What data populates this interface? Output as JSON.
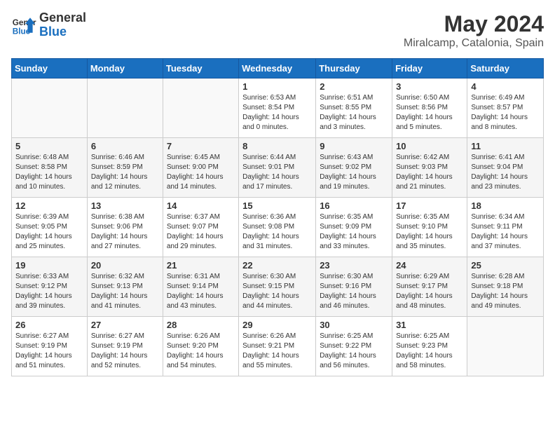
{
  "header": {
    "logo_general": "General",
    "logo_blue": "Blue",
    "month_year": "May 2024",
    "location": "Miralcamp, Catalonia, Spain"
  },
  "days_of_week": [
    "Sunday",
    "Monday",
    "Tuesday",
    "Wednesday",
    "Thursday",
    "Friday",
    "Saturday"
  ],
  "weeks": [
    [
      {
        "day": "",
        "info": ""
      },
      {
        "day": "",
        "info": ""
      },
      {
        "day": "",
        "info": ""
      },
      {
        "day": "1",
        "info": "Sunrise: 6:53 AM\nSunset: 8:54 PM\nDaylight: 14 hours\nand 0 minutes."
      },
      {
        "day": "2",
        "info": "Sunrise: 6:51 AM\nSunset: 8:55 PM\nDaylight: 14 hours\nand 3 minutes."
      },
      {
        "day": "3",
        "info": "Sunrise: 6:50 AM\nSunset: 8:56 PM\nDaylight: 14 hours\nand 5 minutes."
      },
      {
        "day": "4",
        "info": "Sunrise: 6:49 AM\nSunset: 8:57 PM\nDaylight: 14 hours\nand 8 minutes."
      }
    ],
    [
      {
        "day": "5",
        "info": "Sunrise: 6:48 AM\nSunset: 8:58 PM\nDaylight: 14 hours\nand 10 minutes."
      },
      {
        "day": "6",
        "info": "Sunrise: 6:46 AM\nSunset: 8:59 PM\nDaylight: 14 hours\nand 12 minutes."
      },
      {
        "day": "7",
        "info": "Sunrise: 6:45 AM\nSunset: 9:00 PM\nDaylight: 14 hours\nand 14 minutes."
      },
      {
        "day": "8",
        "info": "Sunrise: 6:44 AM\nSunset: 9:01 PM\nDaylight: 14 hours\nand 17 minutes."
      },
      {
        "day": "9",
        "info": "Sunrise: 6:43 AM\nSunset: 9:02 PM\nDaylight: 14 hours\nand 19 minutes."
      },
      {
        "day": "10",
        "info": "Sunrise: 6:42 AM\nSunset: 9:03 PM\nDaylight: 14 hours\nand 21 minutes."
      },
      {
        "day": "11",
        "info": "Sunrise: 6:41 AM\nSunset: 9:04 PM\nDaylight: 14 hours\nand 23 minutes."
      }
    ],
    [
      {
        "day": "12",
        "info": "Sunrise: 6:39 AM\nSunset: 9:05 PM\nDaylight: 14 hours\nand 25 minutes."
      },
      {
        "day": "13",
        "info": "Sunrise: 6:38 AM\nSunset: 9:06 PM\nDaylight: 14 hours\nand 27 minutes."
      },
      {
        "day": "14",
        "info": "Sunrise: 6:37 AM\nSunset: 9:07 PM\nDaylight: 14 hours\nand 29 minutes."
      },
      {
        "day": "15",
        "info": "Sunrise: 6:36 AM\nSunset: 9:08 PM\nDaylight: 14 hours\nand 31 minutes."
      },
      {
        "day": "16",
        "info": "Sunrise: 6:35 AM\nSunset: 9:09 PM\nDaylight: 14 hours\nand 33 minutes."
      },
      {
        "day": "17",
        "info": "Sunrise: 6:35 AM\nSunset: 9:10 PM\nDaylight: 14 hours\nand 35 minutes."
      },
      {
        "day": "18",
        "info": "Sunrise: 6:34 AM\nSunset: 9:11 PM\nDaylight: 14 hours\nand 37 minutes."
      }
    ],
    [
      {
        "day": "19",
        "info": "Sunrise: 6:33 AM\nSunset: 9:12 PM\nDaylight: 14 hours\nand 39 minutes."
      },
      {
        "day": "20",
        "info": "Sunrise: 6:32 AM\nSunset: 9:13 PM\nDaylight: 14 hours\nand 41 minutes."
      },
      {
        "day": "21",
        "info": "Sunrise: 6:31 AM\nSunset: 9:14 PM\nDaylight: 14 hours\nand 43 minutes."
      },
      {
        "day": "22",
        "info": "Sunrise: 6:30 AM\nSunset: 9:15 PM\nDaylight: 14 hours\nand 44 minutes."
      },
      {
        "day": "23",
        "info": "Sunrise: 6:30 AM\nSunset: 9:16 PM\nDaylight: 14 hours\nand 46 minutes."
      },
      {
        "day": "24",
        "info": "Sunrise: 6:29 AM\nSunset: 9:17 PM\nDaylight: 14 hours\nand 48 minutes."
      },
      {
        "day": "25",
        "info": "Sunrise: 6:28 AM\nSunset: 9:18 PM\nDaylight: 14 hours\nand 49 minutes."
      }
    ],
    [
      {
        "day": "26",
        "info": "Sunrise: 6:27 AM\nSunset: 9:19 PM\nDaylight: 14 hours\nand 51 minutes."
      },
      {
        "day": "27",
        "info": "Sunrise: 6:27 AM\nSunset: 9:19 PM\nDaylight: 14 hours\nand 52 minutes."
      },
      {
        "day": "28",
        "info": "Sunrise: 6:26 AM\nSunset: 9:20 PM\nDaylight: 14 hours\nand 54 minutes."
      },
      {
        "day": "29",
        "info": "Sunrise: 6:26 AM\nSunset: 9:21 PM\nDaylight: 14 hours\nand 55 minutes."
      },
      {
        "day": "30",
        "info": "Sunrise: 6:25 AM\nSunset: 9:22 PM\nDaylight: 14 hours\nand 56 minutes."
      },
      {
        "day": "31",
        "info": "Sunrise: 6:25 AM\nSunset: 9:23 PM\nDaylight: 14 hours\nand 58 minutes."
      },
      {
        "day": "",
        "info": ""
      }
    ]
  ]
}
